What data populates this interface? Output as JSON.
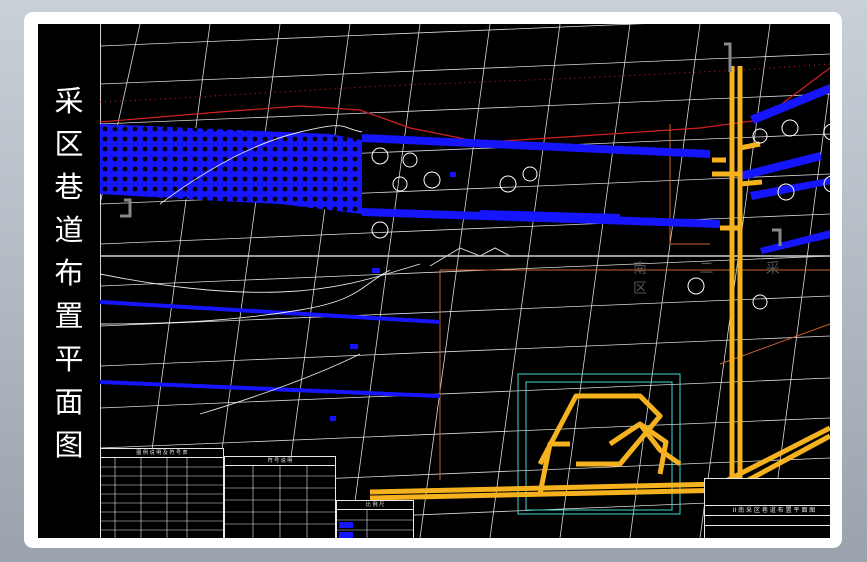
{
  "title": {
    "text": "采区巷道布置平面图",
    "chars": [
      "采",
      "区",
      "巷",
      "道",
      "布",
      "置",
      "平",
      "面",
      "图"
    ]
  },
  "area_label": "南 二 采 区",
  "colors": {
    "background": "#000000",
    "frame": "#ffffff",
    "roadway_main": "#f5b21e",
    "roadway_blue": "#1515ff",
    "grid": "#ffffff",
    "boundary_red": "#d42020",
    "boundary_orange": "#c8642a",
    "shaft_outline": "#3fd6d6"
  },
  "legend_table": {
    "header": "图 例 说 明 及 符 号 表"
  },
  "symbol_table": {
    "header": "符 号 说 明"
  },
  "scale_table": {
    "header": "比 例 尺"
  },
  "title_block": {
    "caption": "II 南 采 区 巷 道 布 置 平 面 图"
  },
  "icons": [
    "borehole-icon",
    "survey-point-icon",
    "north-arrow-icon"
  ]
}
